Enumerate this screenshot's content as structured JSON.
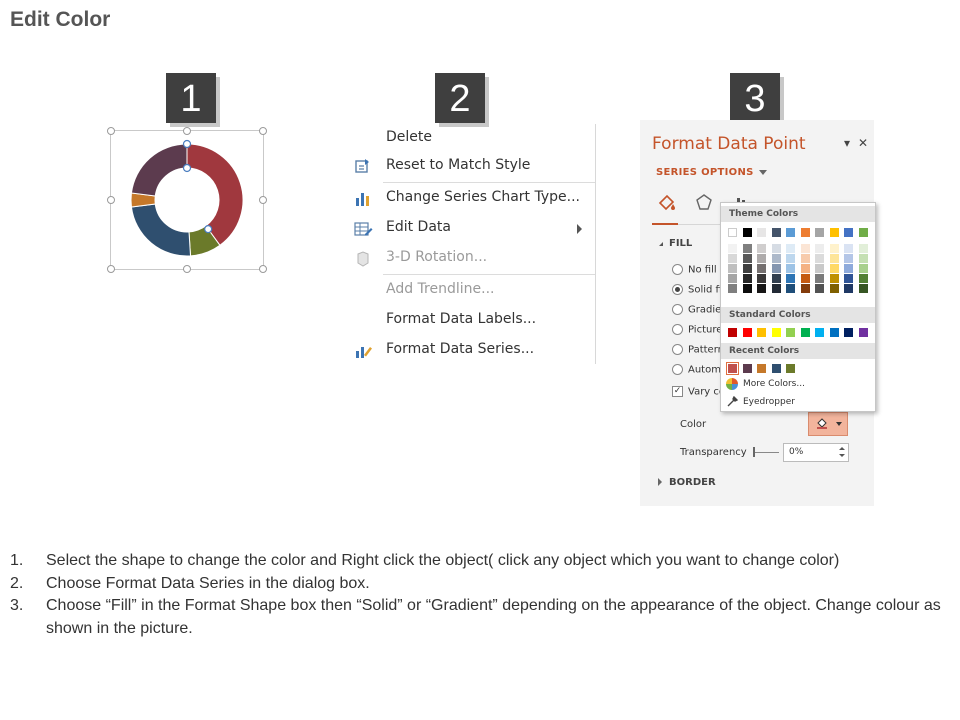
{
  "title": "Edit Color",
  "steps": [
    "1",
    "2",
    "3"
  ],
  "chart_data": {
    "type": "pie",
    "variant": "doughnut",
    "title": "",
    "categories": [
      "",
      "",
      "",
      "",
      ""
    ],
    "values": [
      40,
      9,
      24,
      4,
      23
    ],
    "colors": [
      "#a0383e",
      "#6b7a2a",
      "#2f4f6f",
      "#c5782a",
      "#5c3b4e"
    ],
    "selected_series_handles": true
  },
  "context_menu": {
    "items": [
      {
        "label": "Delete",
        "icon": "",
        "enabled": true
      },
      {
        "label": "Reset to Match Style",
        "icon": "reset-style-icon",
        "enabled": true
      },
      {
        "label": "Change Series Chart Type...",
        "icon": "chart-type-icon",
        "enabled": true
      },
      {
        "label": "Edit Data",
        "icon": "edit-data-icon",
        "enabled": true,
        "submenu": true
      },
      {
        "label": "3-D Rotation...",
        "icon": "rotation-3d-icon",
        "enabled": false
      },
      {
        "label": "Add Trendline...",
        "icon": "",
        "enabled": false
      },
      {
        "label": "Format Data Labels...",
        "icon": "",
        "enabled": true
      },
      {
        "label": "Format Data Series...",
        "icon": "format-series-icon",
        "enabled": true
      }
    ]
  },
  "format_pane": {
    "title": "Format Data Point",
    "dropdown_icon": "caret-down-icon",
    "close_icon": "close-icon",
    "series_options": "SERIES OPTIONS",
    "fill_header": "FILL",
    "fill_options": [
      {
        "label": "No fill",
        "selected": false
      },
      {
        "label": "Solid fi",
        "selected": true
      },
      {
        "label": "Gradier",
        "selected": false
      },
      {
        "label": "Picture",
        "selected": false
      },
      {
        "label": "Pattern",
        "selected": false
      },
      {
        "label": "Autom",
        "selected": false
      }
    ],
    "vary_colors": {
      "label": "Vary co",
      "checked": true
    },
    "color_label": "Color",
    "transparency_label": "Transparency",
    "transparency_value": "0%",
    "border_header": "BORDER",
    "accent": "#c4542a"
  },
  "palette": {
    "theme_header": "Theme Colors",
    "theme_top": [
      "#ffffff",
      "#000000",
      "#e7e6e6",
      "#44546a",
      "#5b9bd5",
      "#ed7d31",
      "#a5a5a5",
      "#ffc000",
      "#4472c4",
      "#70ad47"
    ],
    "theme_shades": [
      [
        "#f2f2f2",
        "#7f7f7f",
        "#d0cece",
        "#d6dce4",
        "#deebf6",
        "#fbe5d5",
        "#ededed",
        "#fff2cc",
        "#dae3f3",
        "#e2efd9"
      ],
      [
        "#d8d8d8",
        "#595959",
        "#aeabab",
        "#adb9ca",
        "#bdd7ee",
        "#f7cbac",
        "#dbdbdb",
        "#fee599",
        "#b4c6e7",
        "#c5e0b3"
      ],
      [
        "#bfbfbf",
        "#3f3f3f",
        "#757070",
        "#8496b0",
        "#9dc3e6",
        "#f4b183",
        "#c9c9c9",
        "#ffd965",
        "#8eaadb",
        "#a8d08d"
      ],
      [
        "#a5a5a5",
        "#262626",
        "#3a3838",
        "#323f4f",
        "#2e75b5",
        "#c55a11",
        "#7b7b7b",
        "#bf9000",
        "#2f5496",
        "#538135"
      ],
      [
        "#7f7f7f",
        "#0c0c0c",
        "#171616",
        "#222a35",
        "#1e4e79",
        "#833c0b",
        "#525252",
        "#7f6000",
        "#1f3864",
        "#375623"
      ]
    ],
    "standard_header": "Standard Colors",
    "standard": [
      "#c00000",
      "#ff0000",
      "#ffc000",
      "#ffff00",
      "#92d050",
      "#00b050",
      "#00b0f0",
      "#0070c0",
      "#002060",
      "#7030a0"
    ],
    "recent_header": "Recent Colors",
    "recent": [
      "#c0504d",
      "#5c3b4e",
      "#c5782a",
      "#2f4f6f",
      "#6b7a2a"
    ],
    "more_colors": "More Colors...",
    "eyedropper": "Eyedropper"
  },
  "instructions": [
    {
      "num": "1.",
      "text": "Select the shape to change the color and Right click the object( click any object which you want to change color)"
    },
    {
      "num": "2.",
      "text": "Choose Format Data Series in the dialog box."
    },
    {
      "num": "3.",
      "text": "Choose “Fill” in the Format Shape box then “Solid” or “Gradient” depending on the appearance of the object. Change colour as shown in the picture."
    }
  ]
}
